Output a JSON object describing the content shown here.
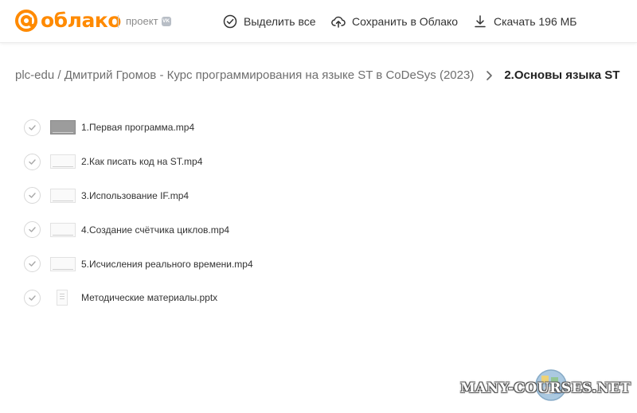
{
  "header": {
    "logo_text": "облако",
    "project_label": "проект",
    "vk_badge": "VK",
    "actions": {
      "select_all": "Выделить все",
      "save_to_cloud": "Сохранить в Облако",
      "download": "Скачать 196 МБ"
    }
  },
  "breadcrumb": {
    "parent": "plc-edu / Дмитрий Громов - Курс программирования на языке ST в CoDeSys (2023)",
    "current": "2.Основы языка ST"
  },
  "files": [
    {
      "name": "1.Первая программа.mp4",
      "type": "video"
    },
    {
      "name": "2.Как писать код на ST.mp4",
      "type": "video"
    },
    {
      "name": "3.Использование IF.mp4",
      "type": "video"
    },
    {
      "name": "4.Создание счётчика циклов.mp4",
      "type": "video"
    },
    {
      "name": "5.Исчисления реального времени.mp4",
      "type": "video"
    },
    {
      "name": "Методические материалы.pptx",
      "type": "document"
    }
  ],
  "watermark": "MANY-COURSES.NET",
  "colors": {
    "brand": "#ff8a00",
    "text": "#333333",
    "muted": "#6f6f6f"
  }
}
